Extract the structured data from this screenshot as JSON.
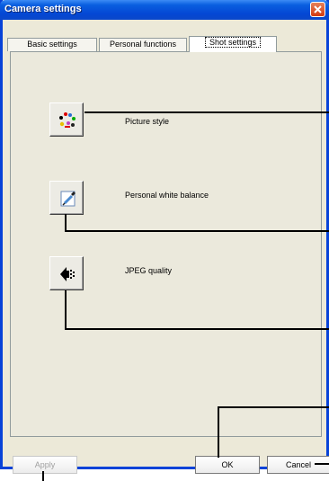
{
  "window": {
    "title": "Camera settings",
    "close_glyph": "✕"
  },
  "tabs": [
    {
      "label": "Basic settings",
      "active": false
    },
    {
      "label": "Personal functions",
      "active": false
    },
    {
      "label": "Shot settings",
      "active": true
    }
  ],
  "items": [
    {
      "label": "Picture style",
      "icon": "picture-style-icon"
    },
    {
      "label": "Personal white balance",
      "icon": "eyedropper-icon"
    },
    {
      "label": "JPEG quality",
      "icon": "jpeg-quality-icon"
    }
  ],
  "buttons": {
    "apply": "Apply",
    "ok": "OK",
    "cancel": "Cancel"
  },
  "colors": {
    "title_bar": "#0a47c9",
    "dialog_bg": "#ece9d8",
    "close_button": "#d43a10"
  }
}
